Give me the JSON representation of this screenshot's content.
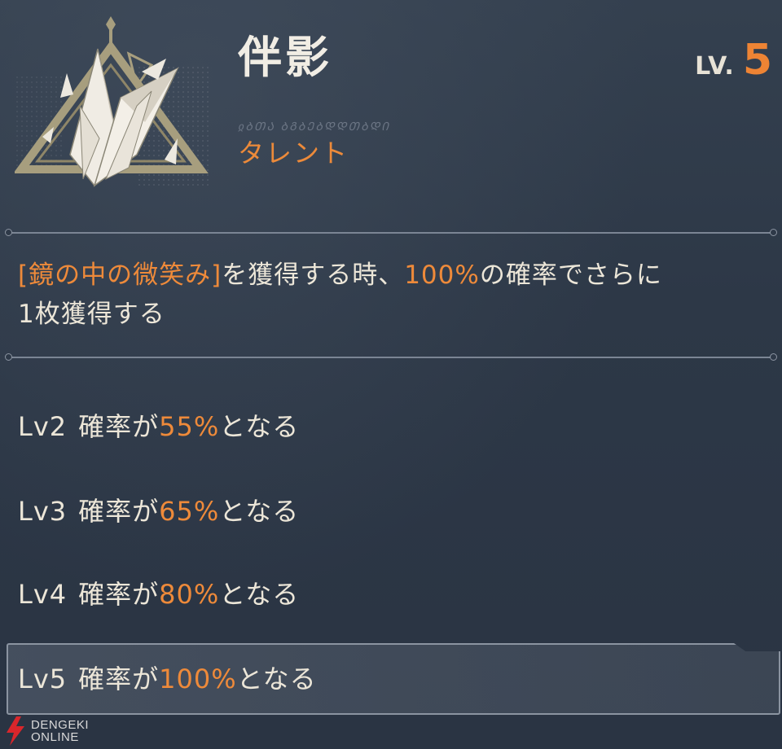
{
  "header": {
    "title": "伴影",
    "script_line": "ჲᲑᲗᲐ ᲑᲒᲑᲔᲑᲓᲓᲗᲑᲓᲘ",
    "category": "タレント",
    "level_label": "LV.",
    "level_value": "5"
  },
  "description": {
    "item_name": "[鏡の中の微笑み]",
    "text_part1": "を獲得する時、",
    "chance": "100%",
    "text_part2": "の確率でさらに",
    "text_line2": "1枚獲得する"
  },
  "levels": [
    {
      "level": "Lv2",
      "prefix": "確率が",
      "percent": "55%",
      "suffix": "となる"
    },
    {
      "level": "Lv3",
      "prefix": "確率が",
      "percent": "65%",
      "suffix": "となる"
    },
    {
      "level": "Lv4",
      "prefix": "確率が",
      "percent": "80%",
      "suffix": "となる"
    },
    {
      "level": "Lv5",
      "prefix": "確率が",
      "percent": "100%",
      "suffix": "となる"
    }
  ],
  "current_level_index": 3,
  "watermark": {
    "line1": "DENGEKI",
    "line2": "ONLINE"
  },
  "colors": {
    "background": "#2c3746",
    "accent_orange": "#ee8a3a",
    "text_light": "#ece6d8",
    "divider": "#7b8594"
  },
  "icons": {
    "emblem": "crystal-shard-triangle-icon",
    "watermark": "lightning-bolt-icon"
  }
}
